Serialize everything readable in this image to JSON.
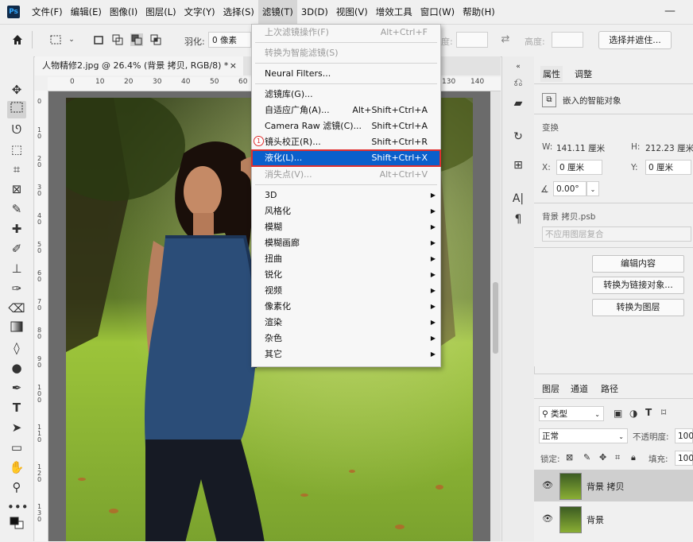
{
  "app": {
    "logo": "Ps",
    "minimize": "—"
  },
  "menubar": {
    "items": [
      "文件(F)",
      "编辑(E)",
      "图像(I)",
      "图层(L)",
      "文字(Y)",
      "选择(S)",
      "滤镜(T)",
      "3D(D)",
      "视图(V)",
      "增效工具",
      "窗口(W)",
      "帮助(H)"
    ],
    "active_index": 6
  },
  "options": {
    "feather_label": "羽化:",
    "feather_value": "0 像素",
    "degree_label": "度:",
    "height_label": "高度:",
    "select_mask_button": "选择并遮住..."
  },
  "document": {
    "tab_title": "人物精修2.jpg @ 26.4% (背景 拷贝, RGB/8) *",
    "tab_close": "×"
  },
  "ruler": {
    "h_ticks": [
      "0",
      "10",
      "20",
      "30",
      "40",
      "50",
      "60",
      "130",
      "140"
    ],
    "v_ticks": [
      "0",
      "1 0",
      "2 0",
      "3 0",
      "4 0",
      "5 0",
      "6 0",
      "7 0",
      "8 0",
      "9 0",
      "1 0 0",
      "1 1 0",
      "1 2 0",
      "1 3 0",
      "1 4 0"
    ]
  },
  "filter_menu": {
    "step_marker": "1",
    "items": [
      {
        "label": "上次滤镜操作(F)",
        "shortcut": "Alt+Ctrl+F",
        "disabled": true
      },
      {
        "label": "转换为智能滤镜(S)",
        "shortcut": "",
        "disabled": true
      },
      {
        "label": "Neural Filters...",
        "shortcut": ""
      },
      {
        "label": "滤镜库(G)...",
        "shortcut": ""
      },
      {
        "label": "自适应广角(A)...",
        "shortcut": "Alt+Shift+Ctrl+A"
      },
      {
        "label": "Camera Raw 滤镜(C)...",
        "shortcut": "Shift+Ctrl+A"
      },
      {
        "label": "镜头校正(R)...",
        "shortcut": "Shift+Ctrl+R"
      },
      {
        "label": "液化(L)...",
        "shortcut": "Shift+Ctrl+X",
        "highlighted": true
      },
      {
        "label": "消失点(V)...",
        "shortcut": "Alt+Ctrl+V",
        "disabled": true
      },
      {
        "label": "3D",
        "submenu": true
      },
      {
        "label": "风格化",
        "submenu": true
      },
      {
        "label": "模糊",
        "submenu": true
      },
      {
        "label": "模糊画廊",
        "submenu": true
      },
      {
        "label": "扭曲",
        "submenu": true
      },
      {
        "label": "锐化",
        "submenu": true
      },
      {
        "label": "视频",
        "submenu": true
      },
      {
        "label": "像素化",
        "submenu": true
      },
      {
        "label": "渲染",
        "submenu": true
      },
      {
        "label": "杂色",
        "submenu": true
      },
      {
        "label": "其它",
        "submenu": true
      }
    ]
  },
  "properties": {
    "tabs": [
      "属性",
      "调整"
    ],
    "type_label": "嵌入的智能对象",
    "transform_title": "变换",
    "w_label": "W:",
    "w_value": "141.11 厘米",
    "h_label": "H:",
    "h_value": "212.23 厘米",
    "x_label": "X:",
    "x_value": "0 厘米",
    "y_label": "Y:",
    "y_value": "0 厘米",
    "angle_value": "0.00°",
    "file_name": "背景 拷贝.psb",
    "comp_placeholder": "不应用图层复合",
    "buttons": [
      "编辑内容",
      "转换为链接对象...",
      "转换为图层"
    ]
  },
  "layers": {
    "tabs": [
      "图层",
      "通道",
      "路径"
    ],
    "filter_kind": "类型",
    "blend_mode": "正常",
    "opacity_label": "不透明度:",
    "opacity_value": "100",
    "lock_label": "锁定:",
    "fill_label": "填充:",
    "fill_value": "100",
    "rows": [
      {
        "name": "背景 拷贝",
        "selected": true
      },
      {
        "name": "背景",
        "selected": false
      }
    ]
  },
  "colors": {
    "highlight": "#0a5fcb",
    "marker": "#e0302f"
  }
}
